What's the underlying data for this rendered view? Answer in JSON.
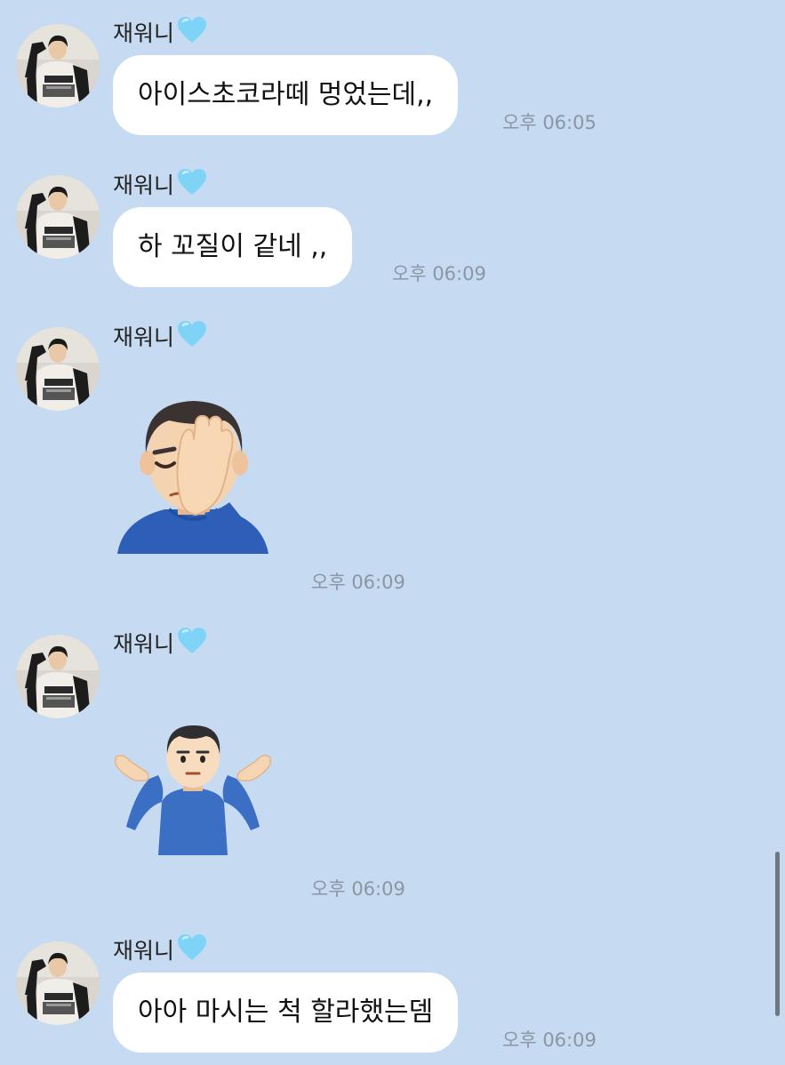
{
  "chat": {
    "sender_name": "재워니",
    "heart_icon": "light-blue-heart-icon",
    "colors": {
      "background": "#c6dbf1",
      "bubble": "#ffffff",
      "timestamp": "#8a96a3",
      "heart": "#7fd3f7"
    },
    "messages": [
      {
        "type": "text",
        "text": "아이스초코라떼 멍었는데,,",
        "time": "오후 06:05"
      },
      {
        "type": "text",
        "text": "하 꼬질이 같네 ,,",
        "time": "오후 06:09"
      },
      {
        "type": "emoji",
        "emoji": "man-facepalming-icon",
        "time": "오후 06:09"
      },
      {
        "type": "emoji",
        "emoji": "man-shrugging-icon",
        "time": "오후 06:09"
      },
      {
        "type": "text",
        "text": "아아 마시는 척 할라했는뎀",
        "time": "오후 06:09"
      }
    ]
  }
}
